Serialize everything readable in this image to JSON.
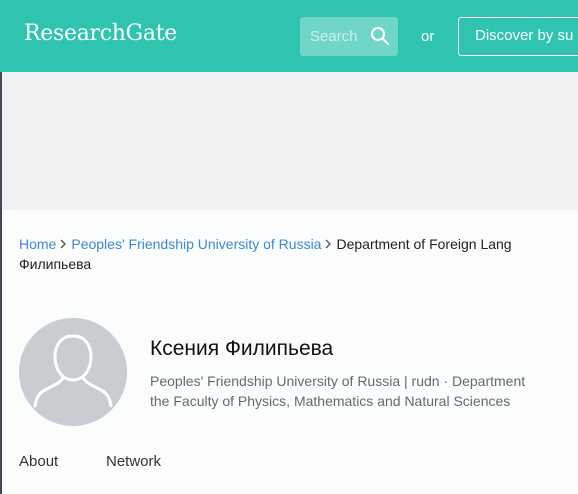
{
  "header": {
    "logo": "ResearchGate",
    "search": {
      "placeholder": "Search",
      "icon": "search-icon"
    },
    "or_text": "or",
    "discover_label": "Discover by su"
  },
  "breadcrumb": {
    "items": [
      "Home",
      "Peoples' Friendship University of Russia",
      "Department of Foreign Lang"
    ],
    "current": "Филипьева"
  },
  "profile": {
    "name": "Ксения Филипьева",
    "affiliation_line1": "Peoples' Friendship University of Russia | rudn · Department",
    "affiliation_line2": "the Faculty of Physics, Mathematics and Natural Sciences"
  },
  "tabs": [
    "About",
    "Network"
  ],
  "colors": {
    "brand": "#2ec4b0",
    "link": "#3c88d6",
    "banner": "#eff1f3",
    "avatar": "#c9ccd0"
  }
}
